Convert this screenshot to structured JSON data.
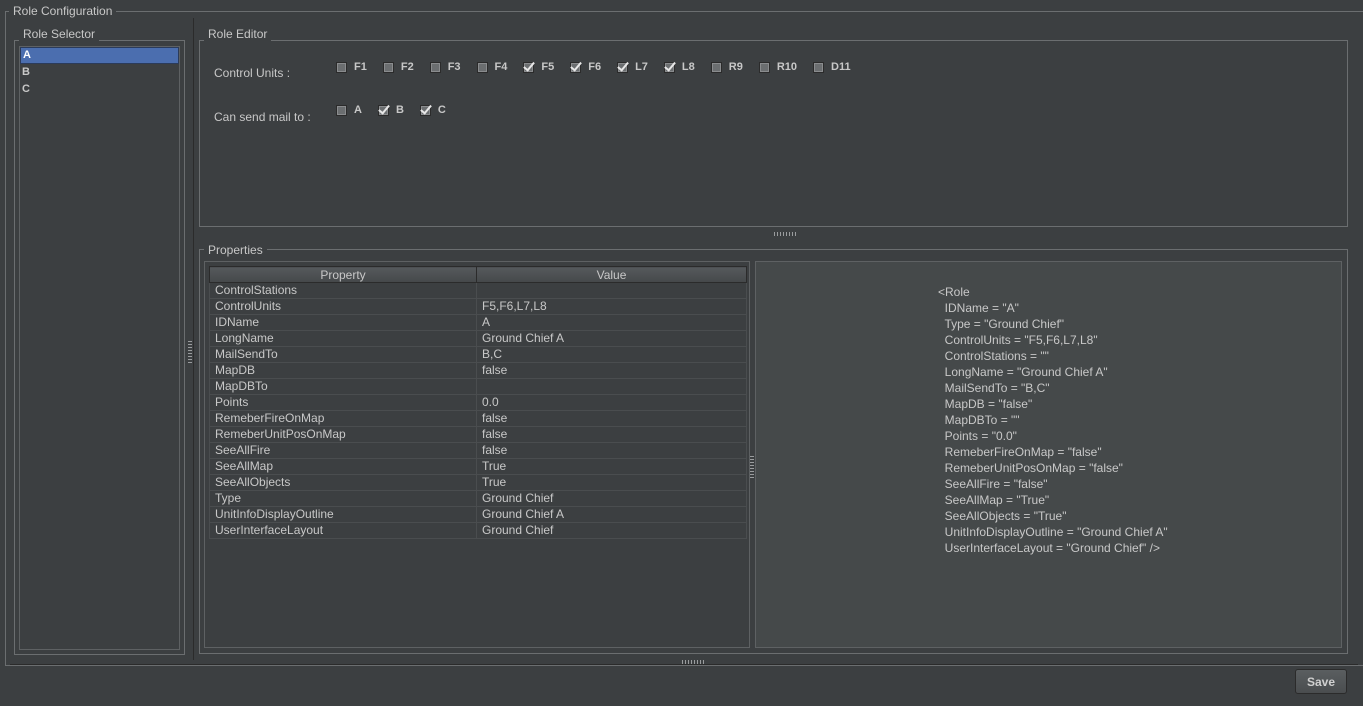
{
  "role_configuration": {
    "title": "Role Configuration"
  },
  "role_selector": {
    "title": "Role Selector",
    "items": [
      "A",
      "B",
      "C"
    ],
    "selected": "A"
  },
  "role_editor": {
    "title": "Role Editor",
    "control_units_label": "Control Units :",
    "control_units": [
      {
        "label": "F1",
        "checked": false
      },
      {
        "label": "F2",
        "checked": false
      },
      {
        "label": "F3",
        "checked": false
      },
      {
        "label": "F4",
        "checked": false
      },
      {
        "label": "F5",
        "checked": true
      },
      {
        "label": "F6",
        "checked": true
      },
      {
        "label": "L7",
        "checked": true
      },
      {
        "label": "L8",
        "checked": true
      },
      {
        "label": "R9",
        "checked": false
      },
      {
        "label": "R10",
        "checked": false
      },
      {
        "label": "D11",
        "checked": false
      }
    ],
    "mail_label": "Can send mail to :",
    "mail_targets": [
      {
        "label": "A",
        "checked": false
      },
      {
        "label": "B",
        "checked": true
      },
      {
        "label": "C",
        "checked": true
      }
    ]
  },
  "properties": {
    "title": "Properties",
    "columns": [
      "Property",
      "Value"
    ],
    "rows": [
      [
        "ControlStations",
        ""
      ],
      [
        "ControlUnits",
        "F5,F6,L7,L8"
      ],
      [
        "IDName",
        "A"
      ],
      [
        "LongName",
        "Ground Chief A"
      ],
      [
        "MailSendTo",
        "B,C"
      ],
      [
        "MapDB",
        "false"
      ],
      [
        "MapDBTo",
        ""
      ],
      [
        "Points",
        "0.0"
      ],
      [
        "RemeberFireOnMap",
        "false"
      ],
      [
        "RemeberUnitPosOnMap",
        "false"
      ],
      [
        "SeeAllFire",
        "false"
      ],
      [
        "SeeAllMap",
        "True"
      ],
      [
        "SeeAllObjects",
        "True"
      ],
      [
        "Type",
        "Ground Chief"
      ],
      [
        "UnitInfoDisplayOutline",
        "Ground Chief A"
      ],
      [
        "UserInterfaceLayout",
        "Ground Chief"
      ]
    ],
    "xml": "<Role\n  IDName = \"A\"\n  Type = \"Ground Chief\"\n  ControlUnits = \"F5,F6,L7,L8\"\n  ControlStations = \"\"\n  LongName = \"Ground Chief A\"\n  MailSendTo = \"B,C\"\n  MapDB = \"false\"\n  MapDBTo = \"\"\n  Points = \"0.0\"\n  RemeberFireOnMap = \"false\"\n  RemeberUnitPosOnMap = \"false\"\n  SeeAllFire = \"false\"\n  SeeAllMap = \"True\"\n  SeeAllObjects = \"True\"\n  UnitInfoDisplayOutline = \"Ground Chief A\"\n  UserInterfaceLayout = \"Ground Chief\" />"
  },
  "save_label": "Save"
}
